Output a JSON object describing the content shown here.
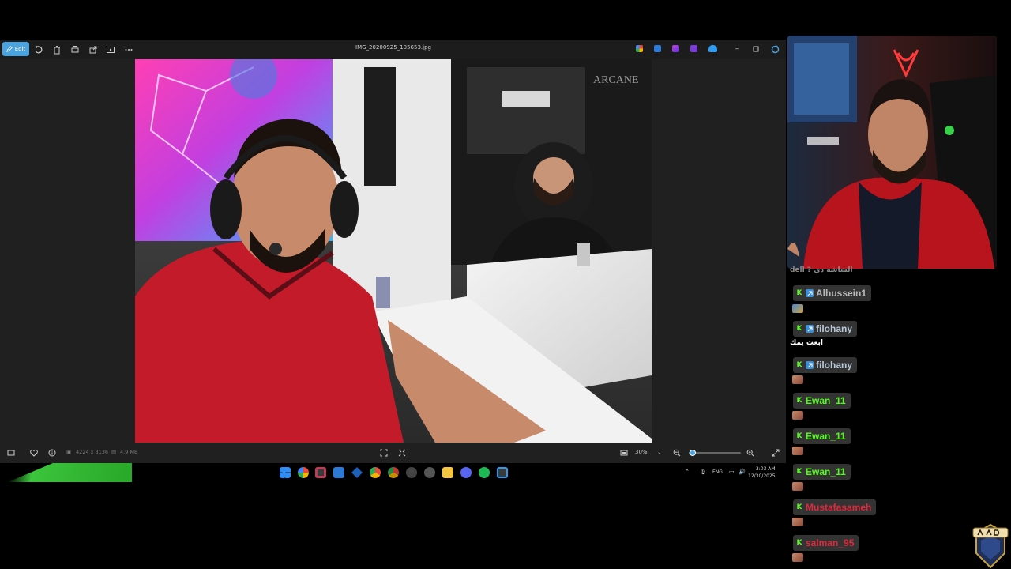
{
  "photos_app": {
    "toolbar": {
      "edit_label": "Edit",
      "file_name": "IMG_20200925_105653.jpg"
    },
    "status": {
      "dimensions": "4224 x 3136",
      "file_size": "4.9 MB",
      "zoom_value": "30%",
      "zoom_fraction": 0.08
    }
  },
  "taskbar": {
    "language": "ENG",
    "time": "3:03 AM",
    "date": "12/30/2025"
  },
  "chat": {
    "partial_message": "dell ? الشاشه دي",
    "messages": [
      {
        "user": "Alhussein1",
        "color": "#b8b8b8",
        "badge": "kick-subscriber",
        "text": ""
      },
      {
        "user": "filohany",
        "color": "#b8c8d8",
        "badge": "kick-subscriber",
        "text": "ابعت يمك"
      },
      {
        "user": "filohany",
        "color": "#b8c8d8",
        "badge": "kick-subscriber",
        "text": ""
      },
      {
        "user": "Ewan_11",
        "color": "#53fc18",
        "badge": "kick",
        "text": ""
      },
      {
        "user": "Ewan_11",
        "color": "#53fc18",
        "badge": "kick",
        "text": ""
      },
      {
        "user": "Ewan_11",
        "color": "#53fc18",
        "badge": "kick",
        "text": ""
      },
      {
        "user": "Mustafasameh",
        "color": "#e0283c",
        "badge": "kick",
        "text": ""
      },
      {
        "user": "salman_95",
        "color": "#e0283c",
        "badge": "kick",
        "text": ""
      }
    ]
  },
  "colors": {
    "accent": "#4aa3df",
    "kick_green": "#53fc18"
  }
}
